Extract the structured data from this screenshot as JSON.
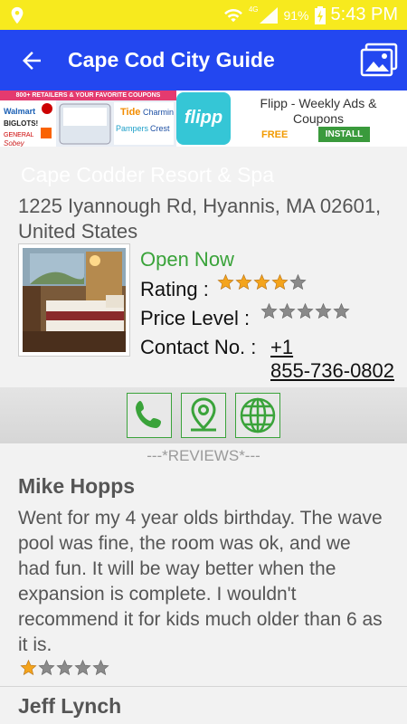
{
  "status_bar": {
    "time": "5:43 PM",
    "battery_percent": "91%",
    "network": "4G"
  },
  "app_bar": {
    "title": "Cape Cod City Guide"
  },
  "ad": {
    "tagline": "800+ RETAILERS & YOUR FAVORITE COUPONS",
    "logo_text": "flipp",
    "name": "Flipp - Weekly Ads & Coupons",
    "price": "FREE",
    "install_label": "INSTALL"
  },
  "place": {
    "name": "Cape Codder Resort & Spa",
    "address": "1225 Iyannough Rd, Hyannis, MA 02601, United States",
    "open_status": "Open Now",
    "rating_label": "Rating :",
    "rating_value": 4,
    "price_label": "Price Level :",
    "price_value": 0,
    "contact_label": "Contact No. :",
    "phone_line1": "+1",
    "phone_line2": "855-736-0802"
  },
  "reviews": {
    "header": "---*REVIEWS*---",
    "items": [
      {
        "author": "Mike Hopps",
        "text": "Went for my 4 year olds birthday.  The wave pool was fine, the room was ok, and we had fun.  It will be way better when the expansion is complete. I wouldn't recommend it for kids much older than 6 as it is.",
        "rating": 1
      },
      {
        "author": "Jeff Lynch"
      }
    ]
  },
  "colors": {
    "status_bar": "#f7ea1e",
    "app_bar": "#2347f0",
    "accent_green": "#3aa33a",
    "star_gold": "#f4a41c",
    "star_grey": "#8a8a8a"
  }
}
